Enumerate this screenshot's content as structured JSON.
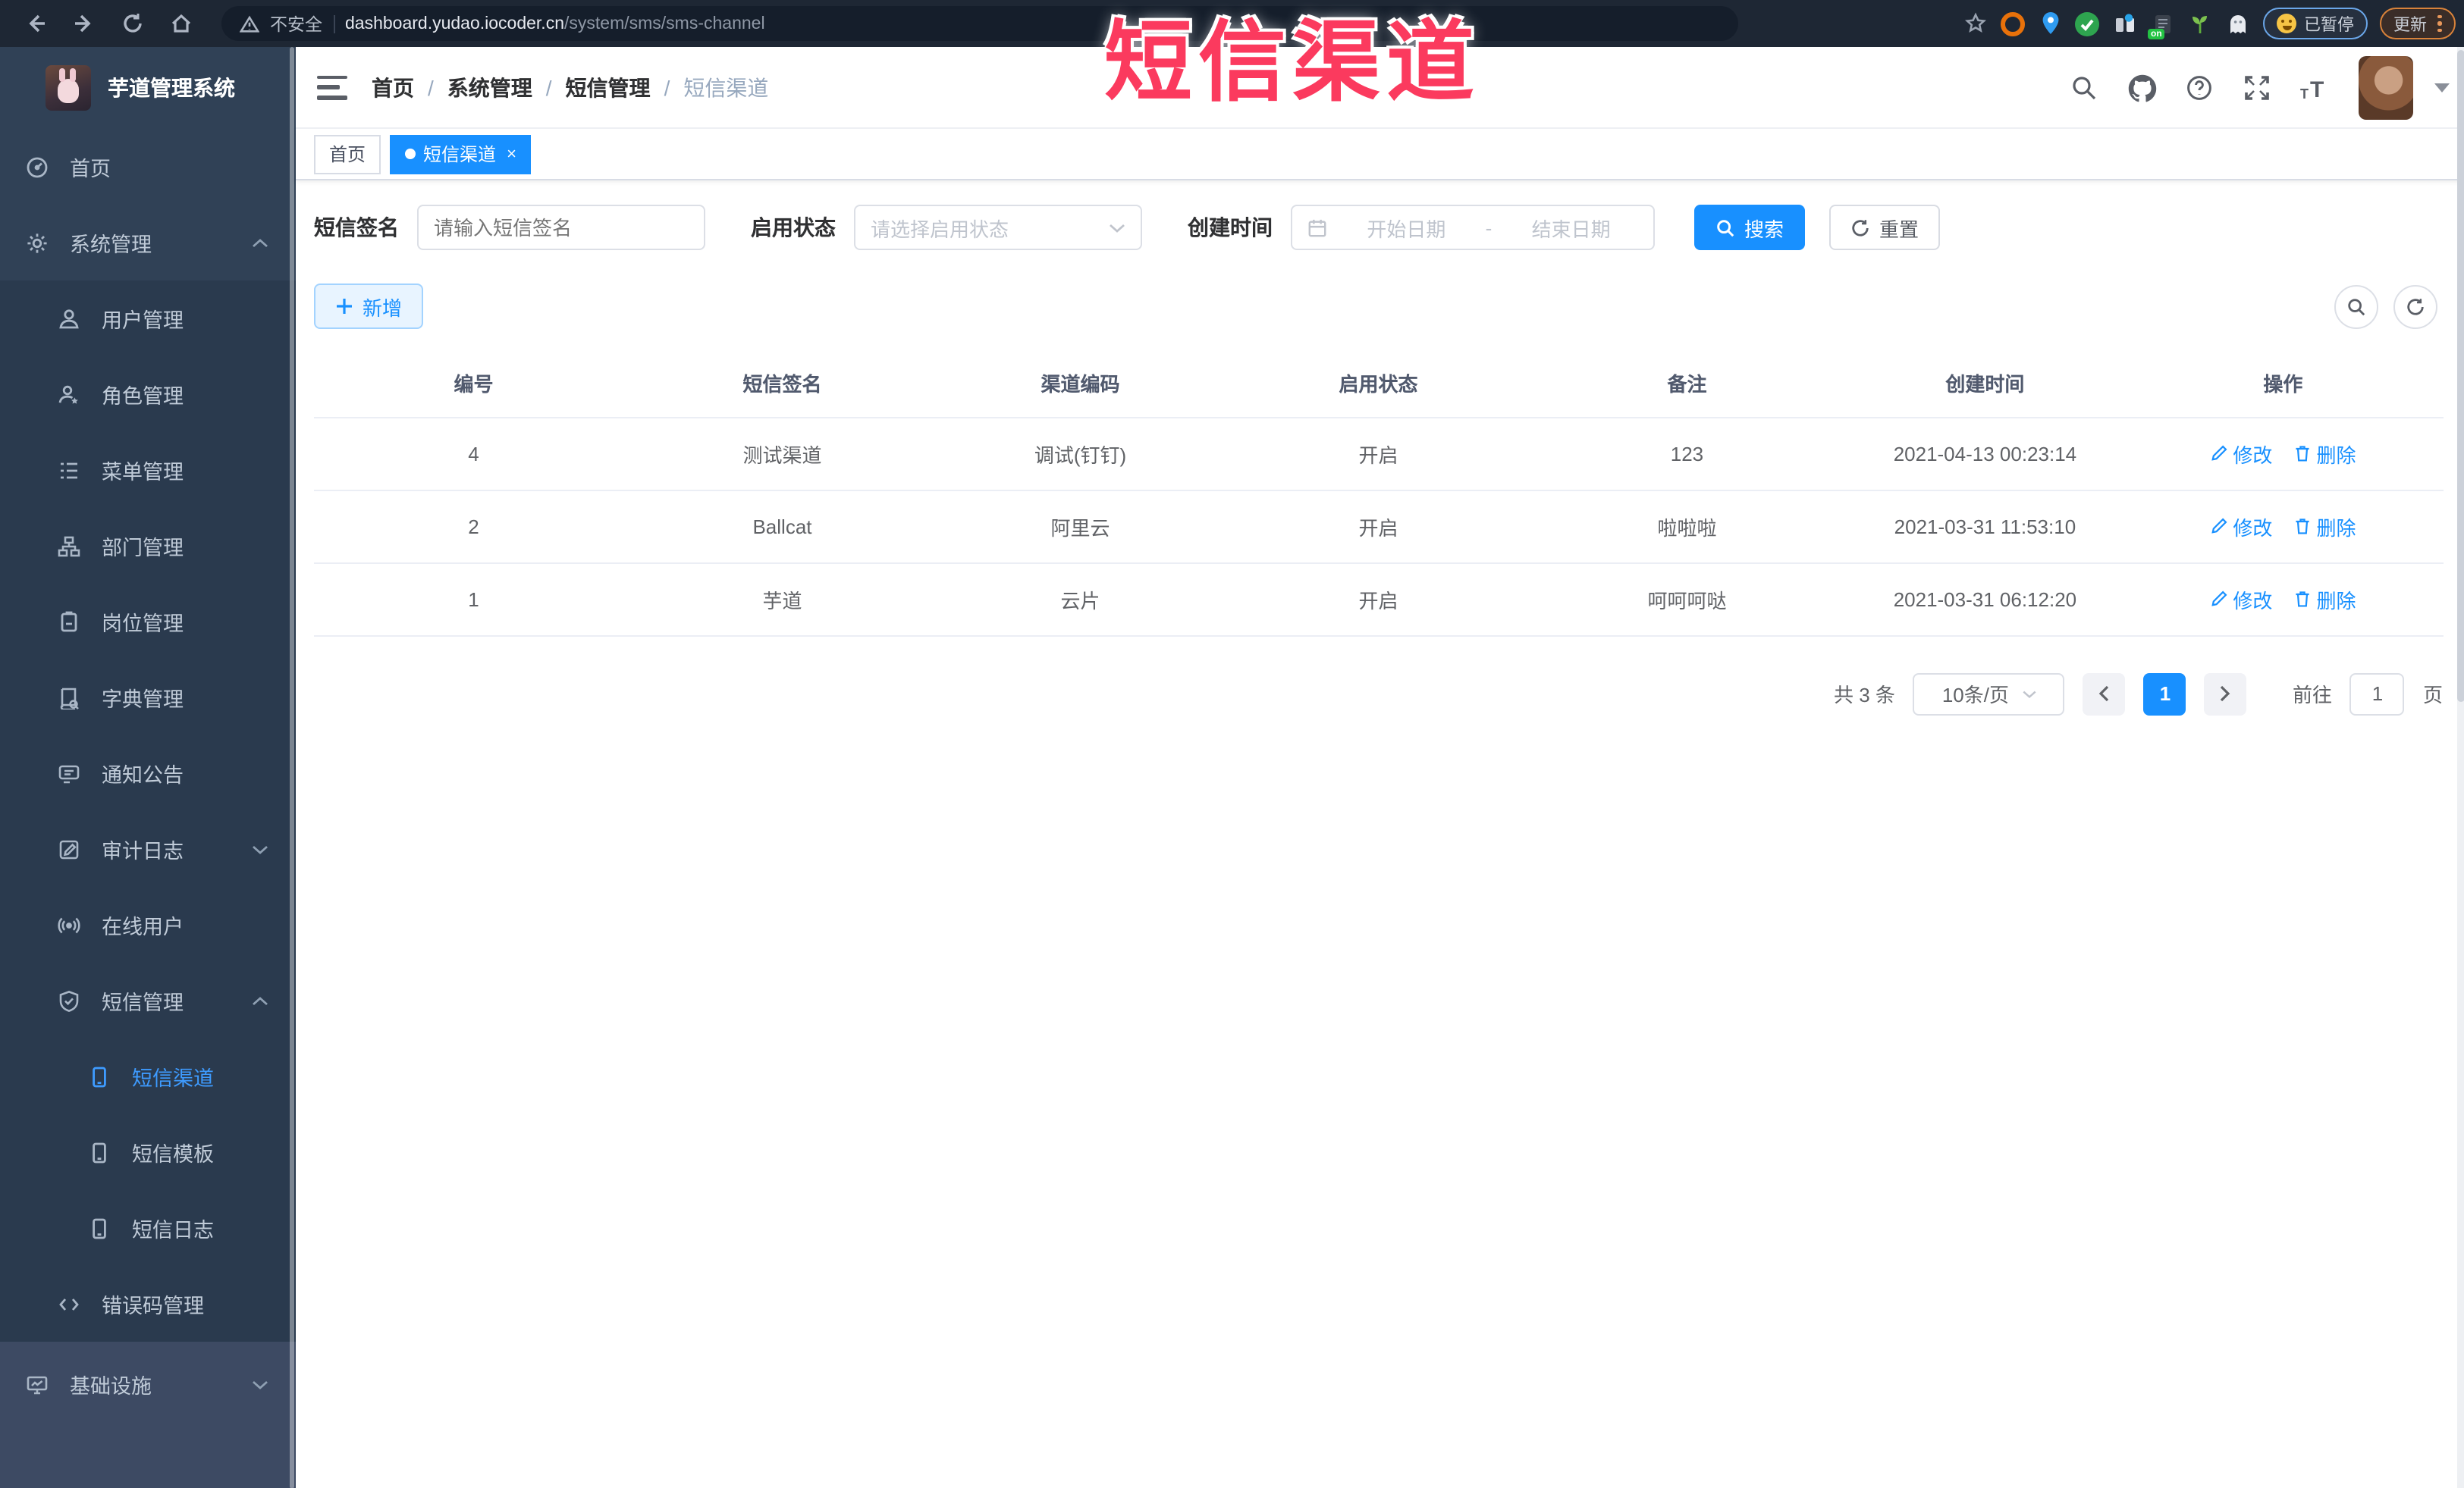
{
  "colors": {
    "accent": "#1890ff",
    "sidebar_bg": "#304156",
    "overlay": "#fb3a5e",
    "active_text": "#3e9bff"
  },
  "browser": {
    "security_label": "不安全",
    "url_host": "dashboard.yudao.iocoder.cn",
    "url_path": "/system/sms/sms-channel",
    "paused_badge": "已暂停",
    "update_button": "更新",
    "on_badge": "on"
  },
  "overlay": {
    "title": "短信渠道"
  },
  "sidebar": {
    "app_title": "芋道管理系统",
    "items": [
      {
        "label": "首页"
      },
      {
        "label": "系统管理"
      },
      {
        "label": "用户管理"
      },
      {
        "label": "角色管理"
      },
      {
        "label": "菜单管理"
      },
      {
        "label": "部门管理"
      },
      {
        "label": "岗位管理"
      },
      {
        "label": "字典管理"
      },
      {
        "label": "通知公告"
      },
      {
        "label": "审计日志"
      },
      {
        "label": "在线用户"
      },
      {
        "label": "短信管理"
      },
      {
        "label": "短信渠道"
      },
      {
        "label": "短信模板"
      },
      {
        "label": "短信日志"
      },
      {
        "label": "错误码管理"
      },
      {
        "label": "基础设施"
      }
    ]
  },
  "header": {
    "breadcrumb": [
      "首页",
      "系统管理",
      "短信管理",
      "短信渠道"
    ],
    "separator": "/"
  },
  "tabs": [
    {
      "label": "首页"
    },
    {
      "label": "短信渠道",
      "close": "×"
    }
  ],
  "filters": {
    "sign_label": "短信签名",
    "sign_placeholder": "请输入短信签名",
    "status_label": "启用状态",
    "status_placeholder": "请选择启用状态",
    "time_label": "创建时间",
    "start_placeholder": "开始日期",
    "range_separator": "-",
    "end_placeholder": "结束日期",
    "search_label": "搜索",
    "reset_label": "重置"
  },
  "toolbar": {
    "add_label": "新增"
  },
  "table": {
    "headers": [
      "编号",
      "短信签名",
      "渠道编码",
      "启用状态",
      "备注",
      "创建时间",
      "操作"
    ],
    "edit_label": "修改",
    "delete_label": "删除",
    "rows": [
      {
        "id": "4",
        "sign": "测试渠道",
        "code": "调试(钉钉)",
        "status": "开启",
        "remark": "123",
        "created": "2021-04-13 00:23:14"
      },
      {
        "id": "2",
        "sign": "Ballcat",
        "code": "阿里云",
        "status": "开启",
        "remark": "啦啦啦",
        "created": "2021-03-31 11:53:10"
      },
      {
        "id": "1",
        "sign": "芋道",
        "code": "云片",
        "status": "开启",
        "remark": "呵呵呵哒",
        "created": "2021-03-31 06:12:20"
      }
    ]
  },
  "pagination": {
    "total_text": "共 3 条",
    "page_size": "10条/页",
    "current_page": "1",
    "goto_label": "前往",
    "goto_value": "1",
    "page_unit": "页"
  }
}
